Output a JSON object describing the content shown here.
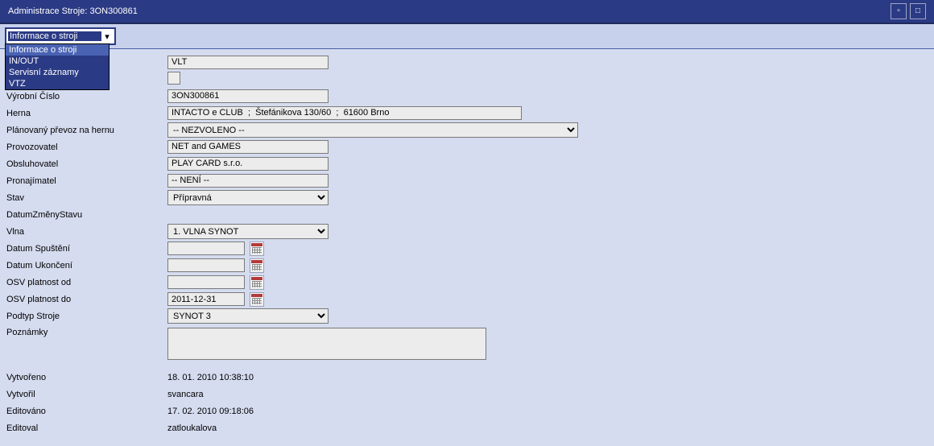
{
  "title": "Administrace Stroje: 3ON300861",
  "dropdown": {
    "selected": "Informace o stroji",
    "items": [
      "Informace o stroji",
      "IN/OUT",
      "Servisní záznamy",
      "VTZ"
    ]
  },
  "labels": {
    "vyrobni_cislo": "Výrobní Číslo",
    "herna": "Herna",
    "planovany_prevoz": "Plánovaný převoz na hernu",
    "provozovatel": "Provozovatel",
    "obsluhovatel": "Obsluhovatel",
    "pronajimatel": "Pronajímatel",
    "stav": "Stav",
    "datum_zmeny_stavu": "DatumZměnyStavu",
    "vlna": "Vlna",
    "datum_spusteni": "Datum Spuštění",
    "datum_ukonceni": "Datum Ukončení",
    "osv_od": "OSV platnost od",
    "osv_do": "OSV platnost do",
    "podtyp": "Podtyp Stroje",
    "poznamky": "Poznámky",
    "vytvoreno": "Vytvořeno",
    "vytvoril": "Vytvořil",
    "editovano": "Editováno",
    "editoval": "Editoval"
  },
  "values": {
    "typ": "VLT",
    "vyrobni_cislo": "3ON300861",
    "herna": "INTACTO e CLUB  ;  Štefánikova 130/60  ;  61600 Brno",
    "planovany_prevoz": "-- NEZVOLENO --",
    "provozovatel": "NET and GAMES",
    "obsluhovatel": "PLAY CARD s.r.o.",
    "pronajimatel": "-- NENÍ --",
    "stav": "Přípravná",
    "datum_zmeny_stavu": "",
    "vlna": "1. VLNA SYNOT",
    "datum_spusteni": "",
    "datum_ukonceni": "",
    "osv_od": "",
    "osv_do": "2011-12-31",
    "podtyp": "SYNOT 3",
    "poznamky": "",
    "vytvoreno": "18. 01. 2010 10:38:10",
    "vytvoril": "svancara",
    "editovano": "17. 02. 2010 09:18:06",
    "editoval": "zatloukalova"
  }
}
